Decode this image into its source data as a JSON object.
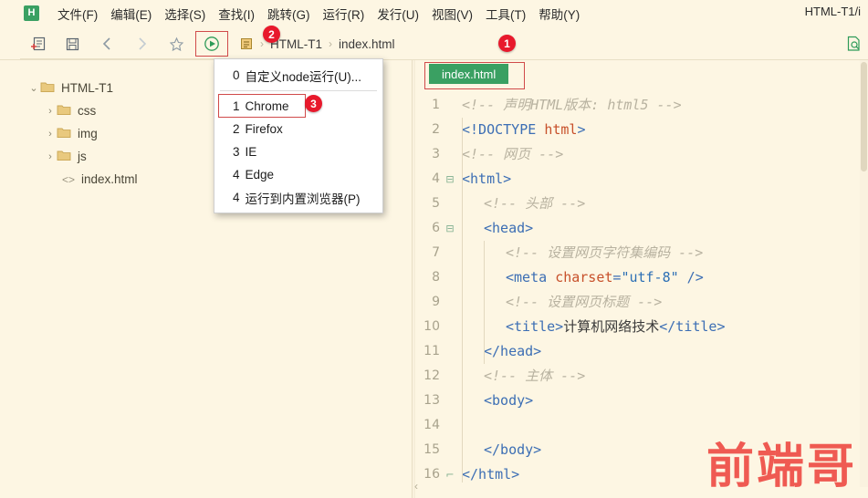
{
  "window": {
    "title": "HTML-T1/i",
    "logo_letter": "H"
  },
  "menubar": {
    "items": [
      {
        "label": "文件(F)",
        "name": "menu-file"
      },
      {
        "label": "编辑(E)",
        "name": "menu-edit"
      },
      {
        "label": "选择(S)",
        "name": "menu-select"
      },
      {
        "label": "查找(I)",
        "name": "menu-find"
      },
      {
        "label": "跳转(G)",
        "name": "menu-goto"
      },
      {
        "label": "运行(R)",
        "name": "menu-run"
      },
      {
        "label": "发行(U)",
        "name": "menu-publish"
      },
      {
        "label": "视图(V)",
        "name": "menu-view"
      },
      {
        "label": "工具(T)",
        "name": "menu-tools"
      },
      {
        "label": "帮助(Y)",
        "name": "menu-help"
      }
    ]
  },
  "toolbar": {
    "icons": [
      "new-file-icon",
      "save-icon",
      "back-arrow-icon",
      "forward-arrow-icon",
      "star-icon",
      "run-play-icon"
    ],
    "run_button_name": "run-play-button",
    "doc_search_icon": "document-search-icon",
    "breadcrumb": {
      "file_icon": "file-badge-icon",
      "separator": "›",
      "items": [
        "HTML-T1",
        "index.html"
      ]
    }
  },
  "badges": [
    {
      "id": "1",
      "label": "1"
    },
    {
      "id": "2",
      "label": "2"
    },
    {
      "id": "3",
      "label": "3"
    }
  ],
  "sidebar": {
    "tree": [
      {
        "label": "HTML-T1",
        "caret": "⌄",
        "icon": "folder-open-icon",
        "level": 0
      },
      {
        "label": "css",
        "caret": "›",
        "icon": "folder-icon",
        "level": 1
      },
      {
        "label": "img",
        "caret": "›",
        "icon": "folder-icon",
        "level": 1
      },
      {
        "label": "js",
        "caret": "›",
        "icon": "folder-icon",
        "level": 1
      },
      {
        "label": "index.html",
        "caret": "",
        "icon": "code-file-icon",
        "level": 2,
        "file_glyph": "<>"
      }
    ]
  },
  "dropdown": {
    "items": [
      {
        "num": "0",
        "label": "自定义node运行(U)...",
        "highlighted": false
      },
      {
        "num": "1",
        "label": "Chrome",
        "highlighted": true
      },
      {
        "num": "2",
        "label": "Firefox",
        "highlighted": false
      },
      {
        "num": "3",
        "label": "IE",
        "highlighted": false
      },
      {
        "num": "4",
        "label": "Edge",
        "highlighted": false
      },
      {
        "num": "4",
        "label": "运行到内置浏览器(P)",
        "highlighted": false
      }
    ]
  },
  "editor": {
    "tab_label": "index.html",
    "watermark": "前端哥",
    "lines": [
      {
        "n": "1",
        "fold": "",
        "indent": 0,
        "tokens": [
          {
            "c": "cm",
            "t": "<!-- 声明HTML版本: html5 -->"
          }
        ]
      },
      {
        "n": "2",
        "fold": "",
        "indent": 0,
        "tokens": [
          {
            "c": "tg",
            "t": "<!DOCTYPE "
          },
          {
            "c": "at",
            "t": "html"
          },
          {
            "c": "tg",
            "t": ">"
          }
        ]
      },
      {
        "n": "3",
        "fold": "",
        "indent": 0,
        "tokens": [
          {
            "c": "cm",
            "t": "<!-- 网页 -->"
          }
        ]
      },
      {
        "n": "4",
        "fold": "⊟",
        "indent": 0,
        "tokens": [
          {
            "c": "tg",
            "t": "<html>"
          }
        ]
      },
      {
        "n": "5",
        "fold": "",
        "indent": 1,
        "tokens": [
          {
            "c": "cm",
            "t": "<!-- 头部 -->"
          }
        ]
      },
      {
        "n": "6",
        "fold": "⊟",
        "indent": 1,
        "tokens": [
          {
            "c": "tg",
            "t": "<head>"
          }
        ]
      },
      {
        "n": "7",
        "fold": "",
        "indent": 2,
        "tokens": [
          {
            "c": "cm",
            "t": "<!-- 设置网页字符集编码 -->"
          }
        ]
      },
      {
        "n": "8",
        "fold": "",
        "indent": 2,
        "tokens": [
          {
            "c": "tg",
            "t": "<meta "
          },
          {
            "c": "at",
            "t": "charset"
          },
          {
            "c": "tg",
            "t": "="
          },
          {
            "c": "vl",
            "t": "\"utf-8\""
          },
          {
            "c": "tg",
            "t": " />"
          }
        ]
      },
      {
        "n": "9",
        "fold": "",
        "indent": 2,
        "tokens": [
          {
            "c": "cm",
            "t": "<!-- 设置网页标题 -->"
          }
        ]
      },
      {
        "n": "10",
        "fold": "",
        "indent": 2,
        "tokens": [
          {
            "c": "tg",
            "t": "<title>"
          },
          {
            "c": "tx",
            "t": "计算机网络技术"
          },
          {
            "c": "tg",
            "t": "</title>"
          }
        ]
      },
      {
        "n": "11",
        "fold": "",
        "indent": 1,
        "tokens": [
          {
            "c": "tg",
            "t": "</head>"
          }
        ]
      },
      {
        "n": "12",
        "fold": "",
        "indent": 1,
        "tokens": [
          {
            "c": "cm",
            "t": "<!-- 主体 -->"
          }
        ]
      },
      {
        "n": "13",
        "fold": "",
        "indent": 1,
        "tokens": [
          {
            "c": "tg",
            "t": "<body>"
          }
        ]
      },
      {
        "n": "14",
        "fold": "",
        "indent": 1,
        "tokens": []
      },
      {
        "n": "15",
        "fold": "",
        "indent": 1,
        "tokens": [
          {
            "c": "tg",
            "t": "</body>"
          }
        ]
      },
      {
        "n": "16",
        "fold": "⌐",
        "indent": 0,
        "tokens": [
          {
            "c": "tg",
            "t": "</html>"
          }
        ]
      }
    ]
  },
  "colors": {
    "background": "#fdf6e3",
    "accent_green": "#3aa062",
    "badge_red": "#e8192c",
    "highlight_red": "#d04a4a",
    "watermark_red": "#ef5a52",
    "comment": "#b8b2a0",
    "tag": "#3c6eb4",
    "attribute": "#c7502a",
    "value": "#2c6fb5"
  }
}
